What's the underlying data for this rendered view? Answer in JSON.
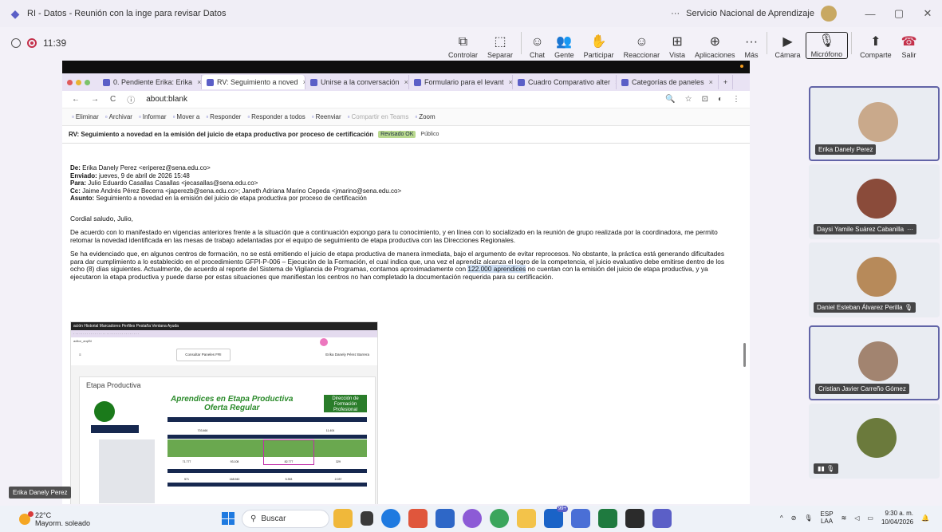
{
  "window": {
    "title": "RI - Datos - Reunión con la inge para revisar Datos",
    "org": "Servicio Nacional de Aprendizaje",
    "more": "···",
    "minimize": "—",
    "restore": "▢",
    "close": "✕"
  },
  "meeting": {
    "time": "11:39",
    "tools": [
      {
        "label": "Controlar",
        "icon": "control-icon",
        "glyph": "⧉"
      },
      {
        "label": "Separar",
        "icon": "separate-icon",
        "glyph": "⬚"
      },
      {
        "label": "Chat",
        "icon": "chat-icon",
        "glyph": "☺"
      },
      {
        "label": "Gente",
        "icon": "people-icon",
        "glyph": "👥"
      },
      {
        "label": "Participar",
        "icon": "raise-hand-icon",
        "glyph": "✋"
      },
      {
        "label": "Reaccionar",
        "icon": "react-icon",
        "glyph": "☺"
      },
      {
        "label": "Vista",
        "icon": "view-icon",
        "glyph": "⊞"
      },
      {
        "label": "Aplicaciones",
        "icon": "apps-icon",
        "glyph": "⊕"
      },
      {
        "label": "Más",
        "icon": "more-icon",
        "glyph": "···"
      },
      {
        "label": "Cámara",
        "icon": "camera-off-icon",
        "glyph": "▶"
      },
      {
        "label": "Micrófono",
        "icon": "mic-off-icon",
        "glyph": "🎙"
      },
      {
        "label": "Comparte",
        "icon": "share-icon",
        "glyph": "⬆"
      },
      {
        "label": "Salir",
        "icon": "leave-icon",
        "glyph": "☎"
      }
    ]
  },
  "browser": {
    "tabs": [
      "0. Pendiente Erika: Erika",
      "RV: Seguimiento a noved",
      "Unirse a la conversación",
      "Formulario para el levant",
      "Cuadro Comparativo alter",
      "Categorías de paneles",
      "+"
    ],
    "address": "about:blank"
  },
  "ribbon": [
    {
      "label": "Eliminar",
      "muted": false
    },
    {
      "label": "Archivar",
      "muted": false
    },
    {
      "label": "Informar",
      "muted": false
    },
    {
      "label": "Mover a",
      "muted": false
    },
    {
      "label": "Responder",
      "muted": false
    },
    {
      "label": "Responder a todos",
      "muted": false
    },
    {
      "label": "Reenviar",
      "muted": false
    },
    {
      "label": "Compartir en Teams",
      "muted": true
    },
    {
      "label": "Zoom",
      "muted": false
    }
  ],
  "email": {
    "subject": "RV: Seguimiento a novedad en la emisión del juicio de etapa productiva por proceso de certificación",
    "badge": "Revisado OK",
    "visibility": "Público",
    "from_label": "De:",
    "from": "Erika Danely Perez <eriperez@sena.edu.co>",
    "sent_label": "Enviado:",
    "sent": "jueves, 9 de abril de 2026 15:48",
    "to_label": "Para:",
    "to": "Julio Eduardo Casallas Casallas <jecasallas@sena.edu.co>",
    "cc_label": "Cc:",
    "cc": "Jaime Andrés Pérez Becerra <japerezb@sena.edu.co>; Janeth Adriana Marino Cepeda <jmarino@sena.edu.co>",
    "subj_label": "Asunto:",
    "subj": "Seguimiento a novedad en la emisión del juicio de etapa productiva por proceso de certificación",
    "greeting": "Cordial saludo, Julio,",
    "p1": "De acuerdo con lo manifestado en vigencias anteriores frente a la situación que a continuación expongo para tu conocimiento, y en línea con lo socializado en la reunión de grupo realizada por la coordinadora, me permito retomar la novedad identificada en las mesas de trabajo adelantadas por el equipo de seguimiento de etapa productiva con las Direcciones Regionales.",
    "p2a": "Se ha evidenciado que, en algunos centros de formación, no se está emitiendo el juicio de etapa productiva de manera inmediata, bajo el argumento de evitar reprocesos. No obstante, la práctica está generando dificultades para dar cumplimiento a lo establecido en el procedimiento GFPI-P-006 – Ejecución de la Formación, el cual indica que, una vez el aprendiz alcanza el logro de la competencia, el juicio evaluativo debe emitirse dentro de los ocho (8) días siguientes. Actualmente, de acuerdo al reporte del Sistema de Vigilancia de Programas, contamos aproximadamente con",
    "p2hl": "122.000 aprendices",
    "p2b": "no cuentan con la emisión del juicio de etapa productiva, y ya ejecutaron la etapa productiva y puede darse por estas situaciones que manifiestan los centros no han completado la documentación requerida para su certificación."
  },
  "inner": {
    "menubar": "ación  Historial  Marcadores  Perfiles  Pestaña           Ventana  Ayuda",
    "address": "aditor_arq/BI",
    "dropdown": "Consultar Paneles FRI",
    "user": "Erika Danely Pérez Barrera",
    "section": "Etapa Productiva",
    "report_title_1": "Aprendices en Etapa Productiva",
    "report_title_2": "Oferta Regular",
    "direction_1": "Dirección de",
    "direction_2": "Formación",
    "direction_3": "Profesional",
    "values": [
      "703.466",
      "11.404",
      "71.777",
      "93.108",
      "82.777",
      "329",
      "571",
      "168.940",
      "5.353",
      "2.037"
    ]
  },
  "participants": [
    {
      "name": "Erika Danely Perez",
      "avatar_color": "#c9a98b",
      "selected": true
    },
    {
      "name": "Daysi Yamile Suárez Cabanilla",
      "avatar_color": "#8a4b3a",
      "selected": false,
      "more": "···"
    },
    {
      "name": "Daniel Esteban Álvarez Perilla",
      "avatar_color": "#b78a5a",
      "selected": false,
      "muted": true
    },
    {
      "name": "Cristian Javier Carreño Gómez",
      "avatar_color": "#a28470",
      "selected": true
    },
    {
      "name": "",
      "avatar_color": "#6b7a3c",
      "selected": false,
      "muted": true
    }
  ],
  "self_label": "Erika Danely Perez",
  "taskbar": {
    "temp": "22°C",
    "weather": "Mayorm. soleado",
    "search": "Buscar",
    "lang1": "ESP",
    "lang2": "LAA",
    "time": "9:30 a. m.",
    "date": "10/04/2026",
    "badge": "99+"
  }
}
